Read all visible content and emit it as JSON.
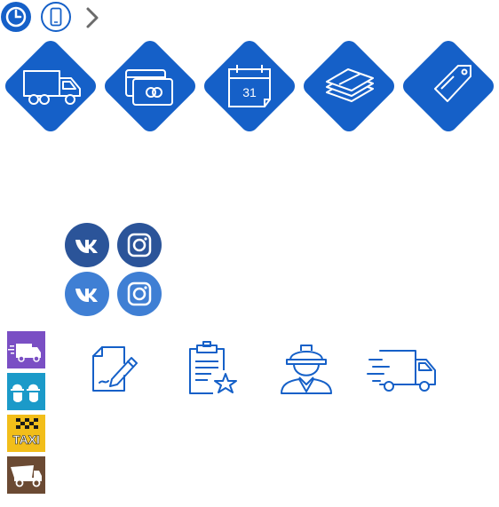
{
  "colors": {
    "primary_blue": "#1560c8",
    "vk_dark": "#2b5499",
    "vk_light": "#3f7fd4",
    "delivery_purple": "#7a4fc4",
    "service_teal": "#1b9ac9",
    "taxi_yellow": "#f2be1a",
    "truck_brown": "#6b4a33"
  },
  "top_icons": [
    "clock-icon",
    "mobile-phone-icon",
    "chevron-right-icon"
  ],
  "diamonds": [
    "delivery-truck-icon",
    "credit-cards-icon",
    "calendar-icon",
    "cash-stack-icon",
    "price-tag-icon"
  ],
  "calendar_day": "31",
  "social": {
    "dark": [
      "vk-icon",
      "instagram-icon"
    ],
    "light": [
      "vk-icon",
      "instagram-icon"
    ]
  },
  "side_squares": [
    "delivery-van-icon",
    "workers-helmets-icon",
    "taxi-icon",
    "dump-truck-icon"
  ],
  "taxi_label": "TAXI",
  "line_icons": [
    "edit-document-icon",
    "clipboard-star-icon",
    "engineer-icon",
    "fast-delivery-truck-icon"
  ]
}
